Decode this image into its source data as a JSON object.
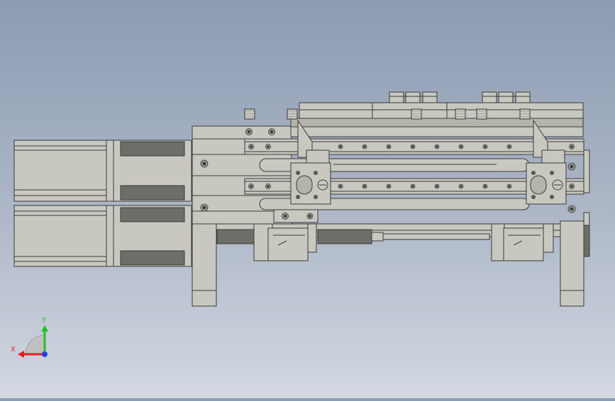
{
  "triad": {
    "x_label": "X",
    "y_label": "Y",
    "x_color": "#e02020",
    "y_color": "#20c020",
    "z_color": "#2040e0"
  },
  "palette": {
    "part_fill": "#c8c8c0",
    "part_stroke": "#3a3a3a",
    "dark_fill": "#6e6e68",
    "rail_fill": "#b4b4ac",
    "background_top": "#8c9bb2",
    "background_bottom": "#d3d8e1"
  }
}
